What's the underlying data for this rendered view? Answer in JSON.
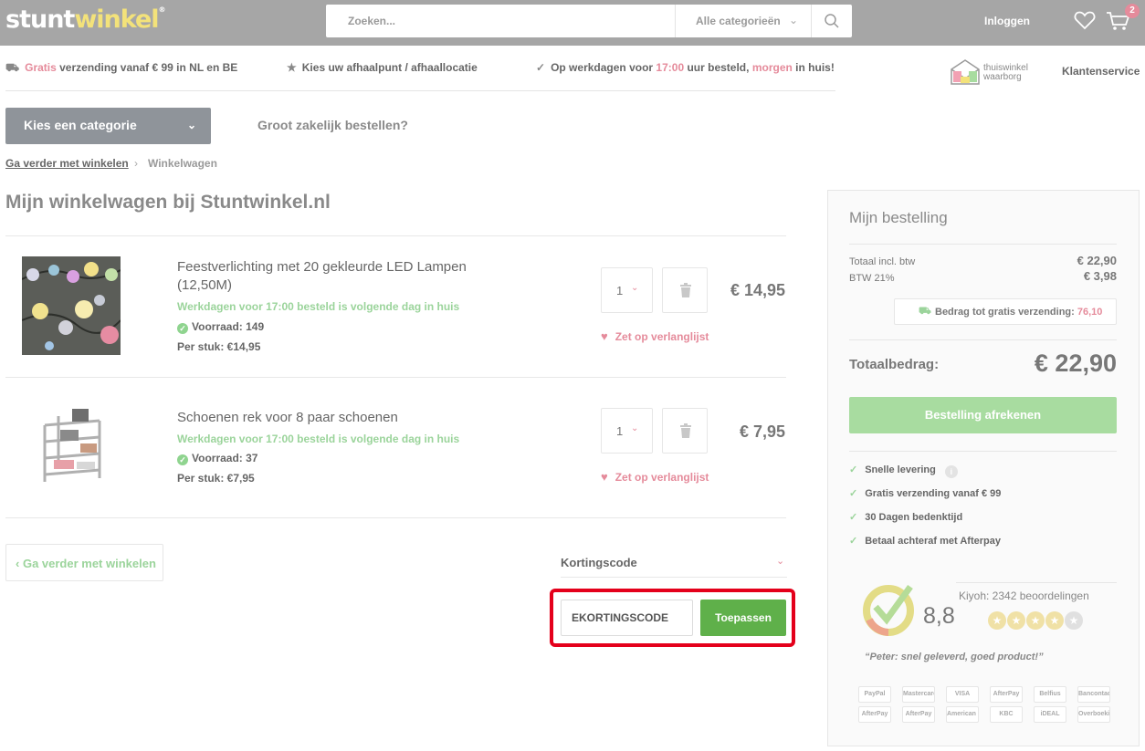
{
  "header": {
    "logo_part1": "stunt",
    "logo_part2": "winkel",
    "logo_reg": "®",
    "search_placeholder": "Zoeken...",
    "category_select": "Alle categorieën",
    "login": "Inloggen",
    "cart_count": "2"
  },
  "usp": {
    "item1_highlight": "Gratis",
    "item1_text": " verzending vanaf € 99 in NL en BE",
    "item2_text": "Kies uw afhaalpunt / afhaallocatie",
    "item3_pre": "Op werkdagen voor ",
    "item3_time": "17:00",
    "item3_mid": " uur besteld, ",
    "item3_day": "morgen",
    "item3_post": " in huis!",
    "thuiswinkel_line1": "thuiswinkel",
    "thuiswinkel_line2": "waarborg",
    "customer_service": "Klantenservice"
  },
  "nav": {
    "category_button": "Kies een categorie",
    "business_link": "Groot zakelijk bestellen?"
  },
  "breadcrumb": {
    "link": "Ga verder met winkelen",
    "separator": "›",
    "current": "Winkelwagen"
  },
  "page_title": "Mijn winkelwagen bij Stuntwinkel.nl",
  "cart_items": [
    {
      "name": "Feestverlichting met 20 gekleurde LED Lampen (12,50M)",
      "delivery": "Werkdagen voor 17:00 besteld is volgende dag in huis",
      "stock": "Voorraad: 149",
      "unit_price": "Per stuk: €14,95",
      "quantity": "1",
      "price": "€ 14,95",
      "wishlist": "Zet op verlanglijst"
    },
    {
      "name": "Schoenen rek voor 8 paar schoenen",
      "delivery": "Werkdagen voor 17:00 besteld is volgende dag in huis",
      "stock": "Voorraad: 37",
      "unit_price": "Per stuk: €7,95",
      "quantity": "1",
      "price": "€ 7,95",
      "wishlist": "Zet op verlanglijst"
    }
  ],
  "actions": {
    "continue_shopping": "Ga verder met winkelen",
    "discount_label": "Kortingscode",
    "discount_value": "EKORTINGSCODE",
    "apply_button": "Toepassen"
  },
  "order_summary": {
    "title": "Mijn bestelling",
    "total_incl_label": "Totaal incl. btw",
    "total_incl_value": "€ 22,90",
    "vat_label": "BTW 21%",
    "vat_value": "€ 3,98",
    "free_shipping_label": "Bedrag tot gratis verzending: ",
    "free_shipping_value": "76,10",
    "grand_total_label": "Totaalbedrag:",
    "grand_total_value": "€ 22,90",
    "checkout_button": "Bestelling afrekenen",
    "usps": [
      "Snelle levering",
      "Gratis verzending vanaf € 99",
      "30 Dagen bedenktijd",
      "Betaal achteraf met Afterpay"
    ],
    "kiyoh_score": "8,8",
    "kiyoh_count": "Kiyoh: 2342 beoordelingen",
    "rating": 4,
    "rating_max": 5,
    "quote": "“Peter: snel geleverd, goed product!”",
    "payment_methods": [
      "PayPal",
      "Mastercard",
      "VISA",
      "AfterPay",
      "Belfius",
      "Bancontact",
      "AfterPay",
      "AfterPay",
      "American Express",
      "KBC",
      "iDEAL",
      "Overboeking"
    ]
  },
  "colors": {
    "accent_pink": "#e58b9b",
    "accent_green": "#5fb04a",
    "highlight_red": "#e4001b",
    "topbar": "#a6a6a6"
  }
}
